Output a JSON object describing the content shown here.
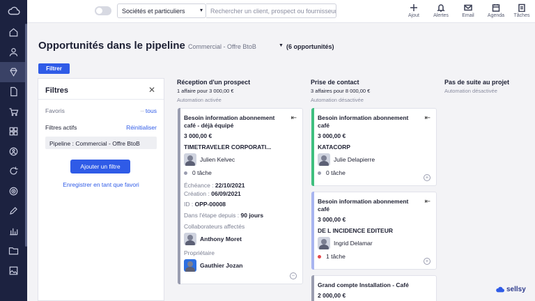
{
  "topbar": {
    "scope_value": "Sociétés et particuliers",
    "search_placeholder": "Rechercher un client, prospect ou fournisseur",
    "tools": [
      {
        "label": "Ajout",
        "icon": "plus-icon"
      },
      {
        "label": "Alertes",
        "icon": "bell-icon"
      },
      {
        "label": "Email",
        "icon": "mail-icon"
      },
      {
        "label": "Agenda",
        "icon": "calendar-icon"
      },
      {
        "label": "Tâches",
        "icon": "tasks-icon"
      }
    ]
  },
  "sidebar": {
    "logo": "cloud-logo",
    "items": [
      "home-icon",
      "contacts-icon",
      "opportunities-icon",
      "documents-icon",
      "shop-icon",
      "catalog-icon",
      "support-icon",
      "subscriptions-icon",
      "marketing-icon",
      "edit-icon",
      "analytics-icon",
      "folder-icon",
      "image-icon"
    ]
  },
  "page": {
    "title": "Opportunités dans le pipeline",
    "pipeline": "Commercial - Offre BtoB",
    "count": "(6 opportunités)",
    "filter_button": "Filtrer"
  },
  "filters": {
    "title": "Filtres",
    "favorites_label": "Favoris",
    "favorites_link": "tous",
    "active_label": "Filtres actifs",
    "reset_link": "Réinitialiser",
    "chip": "Pipeline : Commercial - Offre BtoB",
    "add_button": "Ajouter un filtre",
    "save_link": "Enregistrer en tant que favori"
  },
  "columns": [
    {
      "title": "Réception d'un prospect",
      "summary": "1 affaire pour 3 000,00 €",
      "automation": "Automation activée"
    },
    {
      "title": "Prise de contact",
      "summary": "3 affaires pour 8 000,00 €",
      "automation": "Automation désactivée"
    },
    {
      "title": "Pas de suite au projet",
      "summary": "",
      "automation": "Automation désactivée"
    }
  ],
  "cards": {
    "c1": {
      "title": "Besoin information abonnement café - déjà équipé",
      "amount": "3 000,00 €",
      "company": "TIMETRAVELER CORPORATI...",
      "owner": "Julien Kelvec",
      "tasks": "0 tâche",
      "due_label": "Échéance :",
      "due": "22/10/2021",
      "created_label": "Création :",
      "created": "06/09/2021",
      "id_label": "ID :",
      "id": "OPP-00008",
      "stage_label": "Dans l'étape depuis :",
      "stage": "90 jours",
      "collab_label": "Collaborateurs affectés",
      "collab": "Anthony Moret",
      "owner_label": "Propriétaire",
      "owner2": "Gauthier Jozan",
      "accent": "#9a9db0"
    },
    "c2": {
      "title": "Besoin information abonnement café",
      "amount": "3 000,00 €",
      "company": "KATACORP",
      "owner": "Julie Delapierre",
      "tasks": "0 tâche",
      "accent": "#3fbf7f"
    },
    "c3": {
      "title": "Besoin information abonnement café",
      "amount": "3 000,00 €",
      "company": "DE L INCIDENCE EDITEUR",
      "owner": "Ingrid Delamar",
      "tasks": "1 tâche",
      "accent": "#a8b4f0"
    },
    "c4": {
      "title": "Grand compte Installation - Café",
      "amount": "2 000,00 €"
    }
  },
  "brand": "sellsy",
  "colors": {
    "primary": "#2f5be7",
    "sidebar": "#1c2240"
  }
}
